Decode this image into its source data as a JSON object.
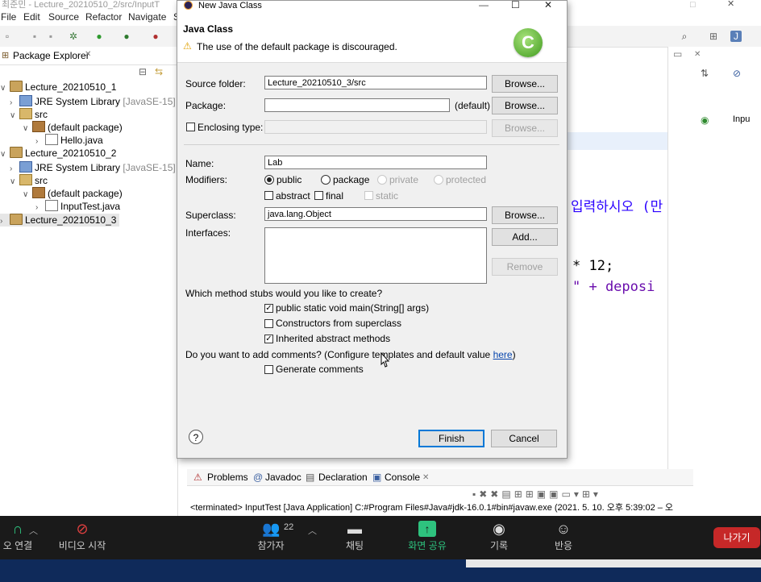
{
  "eclipse": {
    "window_title": "최준민 - Lecture_20210510_2/src/InputT",
    "menu": [
      "File",
      "Edit",
      "Source",
      "Refactor",
      "Navigate",
      "S"
    ],
    "pkg_explorer_title": "Package Explorer",
    "tree": [
      {
        "label": "Lecture_20210510_1",
        "suffix": ""
      },
      {
        "label": "JRE System Library",
        "suffix": "[JavaSE-15]"
      },
      {
        "label": "src",
        "suffix": ""
      },
      {
        "label": "(default package)",
        "suffix": ""
      },
      {
        "label": "Hello.java",
        "suffix": ""
      },
      {
        "label": "Lecture_20210510_2",
        "suffix": ""
      },
      {
        "label": "JRE System Library",
        "suffix": "[JavaSE-15]"
      },
      {
        "label": "src",
        "suffix": ""
      },
      {
        "label": "(default package)",
        "suffix": ""
      },
      {
        "label": "InputTest.java",
        "suffix": ""
      },
      {
        "label": "Lecture_20210510_3",
        "suffix": ""
      }
    ],
    "editor_lines": [
      "입력하시오 (만",
      "* 12;",
      "\" + deposi"
    ],
    "outline_item": "Inpu",
    "bottom_tabs": [
      "Problems",
      "Javadoc",
      "Declaration",
      "Console"
    ],
    "console_text": "<terminated> InputTest [Java Application] C:#Program Files#Java#jdk-16.0.1#bin#javaw.exe  (2021. 5. 10. 오후 5:39:02 – 오"
  },
  "dialog": {
    "title": "New Java Class",
    "heading": "Java Class",
    "warning": "The use of the default package is discouraged.",
    "source_folder_label": "Source folder:",
    "source_folder_value": "Lecture_20210510_3/src",
    "package_label": "Package:",
    "package_value": "",
    "package_default": "(default)",
    "enclosing_type_label": "Enclosing type:",
    "name_label": "Name:",
    "name_value": "Lab",
    "modifiers_label": "Modifiers:",
    "mod_public": "public",
    "mod_package": "package",
    "mod_private": "private",
    "mod_protected": "protected",
    "mod_abstract": "abstract",
    "mod_final": "final",
    "mod_static": "static",
    "superclass_label": "Superclass:",
    "superclass_value": "java.lang.Object",
    "interfaces_label": "Interfaces:",
    "browse": "Browse...",
    "add": "Add...",
    "remove": "Remove",
    "stubs_question": "Which method stubs would you like to create?",
    "stub_main": "public static void main(String[] args)",
    "stub_constructors": "Constructors from superclass",
    "stub_inherited": "Inherited abstract methods",
    "comments_question": "Do you want to add comments? (Configure templates and default value ",
    "comments_link": "here",
    "comments_close": ")",
    "generate_comments": "Generate comments",
    "finish": "Finish",
    "cancel": "Cancel",
    "help": "?"
  },
  "zoom": {
    "audio": "오 연결",
    "video": "비디오 시작",
    "participants": "참가자",
    "participants_count": "22",
    "chat": "채팅",
    "share": "화면 공유",
    "record": "기록",
    "reactions": "반응",
    "leave": "나가기"
  }
}
